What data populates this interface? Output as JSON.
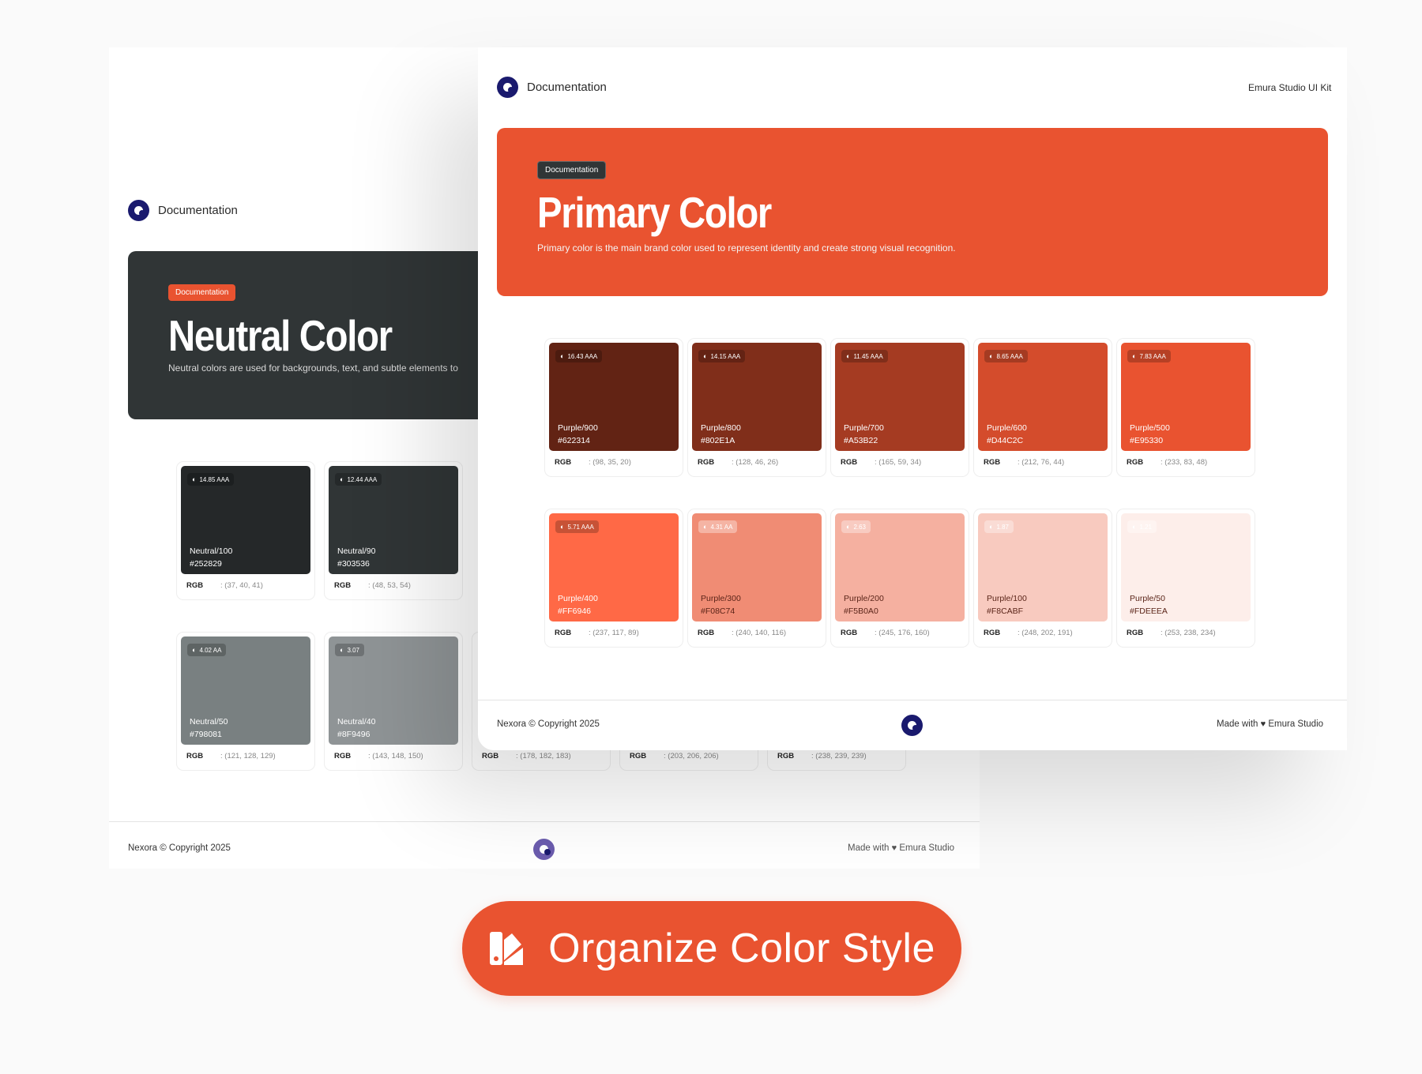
{
  "colors": {
    "accent": "#E95330",
    "dark": "#303536",
    "logo": "#1a1a6e"
  },
  "back_page": {
    "header_title": "Documentation",
    "hero": {
      "badge": "Documentation",
      "title": "Neutral Color",
      "description": "Neutral colors are used for backgrounds, text, and subtle elements to"
    },
    "swatches": [
      {
        "contrast": "14.85 AAA",
        "name": "Neutral/100",
        "hex": "#252829",
        "rgb_label": "RGB",
        "rgb": ": (37, 40, 41)",
        "color": "#252829",
        "text": "light"
      },
      {
        "contrast": "12.44 AAA",
        "name": "Neutral/90",
        "hex": "#303536",
        "rgb_label": "RGB",
        "rgb": ": (48, 53, 54)",
        "color": "#303536",
        "text": "light"
      },
      {
        "contrast": "4.02 AA",
        "name": "Neutral/50",
        "hex": "#798081",
        "rgb_label": "RGB",
        "rgb": ": (121, 128, 129)",
        "color": "#798081",
        "text": "light"
      },
      {
        "contrast": "3.07",
        "name": "Neutral/40",
        "hex": "#8F9496",
        "rgb_label": "RGB",
        "rgb": ": (143, 148, 150)",
        "color": "#8F9496",
        "text": "light"
      }
    ],
    "partial_rgb_rows": [
      {
        "label": "RGB",
        "value": ": (178, 182, 183)"
      },
      {
        "label": "RGB",
        "value": ": (203, 206, 206)"
      },
      {
        "label": "RGB",
        "value": ": (238, 239, 239)"
      }
    ],
    "footer": {
      "copyright": "Nexora © Copyright 2025",
      "made_with": "Made with",
      "studio": "Emura Studio"
    }
  },
  "front_page": {
    "header_title": "Documentation",
    "kit_label": "Emura Studio UI Kit",
    "hero": {
      "badge": "Documentation",
      "title": "Primary Color",
      "description": "Primary color is the main brand color used to represent identity and create strong visual recognition."
    },
    "swatches": [
      {
        "contrast": "16.43 AAA",
        "name": "Purple/900",
        "hex": "#622314",
        "rgb_label": "RGB",
        "rgb": ": (98, 35, 20)",
        "color": "#622314",
        "text": "light"
      },
      {
        "contrast": "14.15 AAA",
        "name": "Purple/800",
        "hex": "#802E1A",
        "rgb_label": "RGB",
        "rgb": ": (128, 46, 26)",
        "color": "#802E1A",
        "text": "light"
      },
      {
        "contrast": "11.45 AAA",
        "name": "Purple/700",
        "hex": "#A53B22",
        "rgb_label": "RGB",
        "rgb": ": (165, 59, 34)",
        "color": "#A53B22",
        "text": "light"
      },
      {
        "contrast": "8.65 AAA",
        "name": "Purple/600",
        "hex": "#D44C2C",
        "rgb_label": "RGB",
        "rgb": ": (212, 76, 44)",
        "color": "#D44C2C",
        "text": "light"
      },
      {
        "contrast": "7.83 AAA",
        "name": "Purple/500",
        "hex": "#E95330",
        "rgb_label": "RGB",
        "rgb": ": (233, 83, 48)",
        "color": "#E95330",
        "text": "light"
      },
      {
        "contrast": "5.71 AAA",
        "name": "Purple/400",
        "hex": "#FF6946",
        "rgb_label": "RGB",
        "rgb": ": (237, 117, 89)",
        "color": "#FF6946",
        "text": "light"
      },
      {
        "contrast": "4.31 AA",
        "name": "Purple/300",
        "hex": "#F08C74",
        "rgb_label": "RGB",
        "rgb": ": (240, 140, 116)",
        "color": "#F08C74",
        "text": "dark"
      },
      {
        "contrast": "2.63",
        "name": "Purple/200",
        "hex": "#F5B0A0",
        "rgb_label": "RGB",
        "rgb": ": (245, 176, 160)",
        "color": "#F5B0A0",
        "text": "dark"
      },
      {
        "contrast": "1.87",
        "name": "Purple/100",
        "hex": "#F8CABF",
        "rgb_label": "RGB",
        "rgb": ": (248, 202, 191)",
        "color": "#F8CABF",
        "text": "dark"
      },
      {
        "contrast": "1.21",
        "name": "Purple/50",
        "hex": "#FDEEEA",
        "rgb_label": "RGB",
        "rgb": ": (253, 238, 234)",
        "color": "#FDEEEA",
        "text": "dark"
      }
    ],
    "footer": {
      "copyright": "Nexora © Copyright 2025",
      "made_with": "Made with",
      "studio": "Emura Studio"
    }
  },
  "cta": {
    "label": "Organize Color Style",
    "icon": "color-palette-icon"
  }
}
